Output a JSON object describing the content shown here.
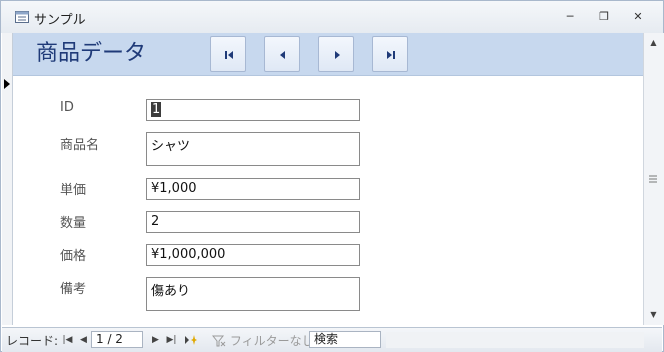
{
  "window": {
    "title": "サンプル",
    "controls": {
      "minimize": "─",
      "restore": "❐",
      "close": "✕"
    }
  },
  "form": {
    "title": "商品データ",
    "nav_buttons": [
      "first-record",
      "previous-record",
      "next-record",
      "last-record"
    ]
  },
  "fields": [
    {
      "label": "ID",
      "value": "1"
    },
    {
      "label": "商品名",
      "value": "シャツ"
    },
    {
      "label": "単価",
      "value": "¥1,000"
    },
    {
      "label": "数量",
      "value": "2"
    },
    {
      "label": "価格",
      "value": "¥1,000,000"
    },
    {
      "label": "備考",
      "value": "傷あり"
    }
  ],
  "statusbar": {
    "record_label": "レコード:",
    "record_position": "1 / 2",
    "filter_label": "フィルターなし",
    "search_placeholder": "検索"
  },
  "colors": {
    "header_bg": "#c7d8ee",
    "title_color": "#1f3a78",
    "window_border": "#a9b8cc"
  }
}
